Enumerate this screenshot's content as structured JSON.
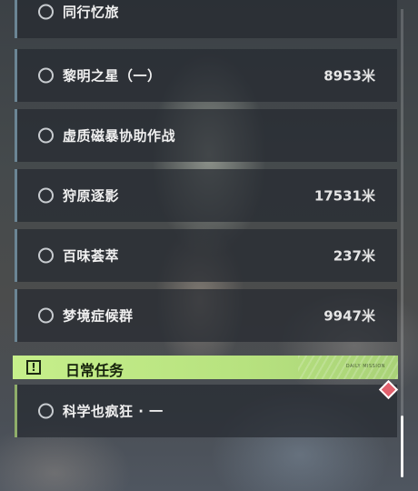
{
  "quests": [
    {
      "name": "同行忆旅",
      "distance": ""
    },
    {
      "name": "黎明之星（一）",
      "distance": "8953米"
    },
    {
      "name": "虚质磁暴协助作战",
      "distance": ""
    },
    {
      "name": "狩原逐影",
      "distance": "17531米"
    },
    {
      "name": "百味荟萃",
      "distance": "237米"
    },
    {
      "name": "梦境症候群",
      "distance": "9947米"
    }
  ],
  "daily_section": {
    "title": "日常任务",
    "badge_icon": "!",
    "tag": "DAILY MISSION",
    "accent_color": "#c0eb84"
  },
  "daily_quests": [
    {
      "name": "科学也疯狂 · 一",
      "distance": ""
    }
  ]
}
